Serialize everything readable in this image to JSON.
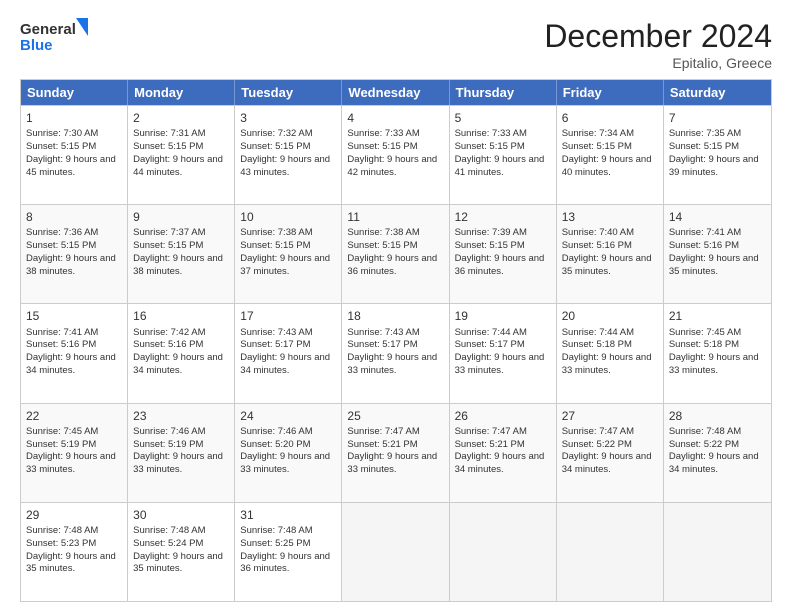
{
  "header": {
    "logo_line1": "General",
    "logo_line2": "Blue",
    "month_title": "December 2024",
    "location": "Epitalio, Greece"
  },
  "weekdays": [
    "Sunday",
    "Monday",
    "Tuesday",
    "Wednesday",
    "Thursday",
    "Friday",
    "Saturday"
  ],
  "rows": [
    [
      {
        "day": "1",
        "sunrise": "Sunrise: 7:30 AM",
        "sunset": "Sunset: 5:15 PM",
        "daylight": "Daylight: 9 hours and 45 minutes."
      },
      {
        "day": "2",
        "sunrise": "Sunrise: 7:31 AM",
        "sunset": "Sunset: 5:15 PM",
        "daylight": "Daylight: 9 hours and 44 minutes."
      },
      {
        "day": "3",
        "sunrise": "Sunrise: 7:32 AM",
        "sunset": "Sunset: 5:15 PM",
        "daylight": "Daylight: 9 hours and 43 minutes."
      },
      {
        "day": "4",
        "sunrise": "Sunrise: 7:33 AM",
        "sunset": "Sunset: 5:15 PM",
        "daylight": "Daylight: 9 hours and 42 minutes."
      },
      {
        "day": "5",
        "sunrise": "Sunrise: 7:33 AM",
        "sunset": "Sunset: 5:15 PM",
        "daylight": "Daylight: 9 hours and 41 minutes."
      },
      {
        "day": "6",
        "sunrise": "Sunrise: 7:34 AM",
        "sunset": "Sunset: 5:15 PM",
        "daylight": "Daylight: 9 hours and 40 minutes."
      },
      {
        "day": "7",
        "sunrise": "Sunrise: 7:35 AM",
        "sunset": "Sunset: 5:15 PM",
        "daylight": "Daylight: 9 hours and 39 minutes."
      }
    ],
    [
      {
        "day": "8",
        "sunrise": "Sunrise: 7:36 AM",
        "sunset": "Sunset: 5:15 PM",
        "daylight": "Daylight: 9 hours and 38 minutes."
      },
      {
        "day": "9",
        "sunrise": "Sunrise: 7:37 AM",
        "sunset": "Sunset: 5:15 PM",
        "daylight": "Daylight: 9 hours and 38 minutes."
      },
      {
        "day": "10",
        "sunrise": "Sunrise: 7:38 AM",
        "sunset": "Sunset: 5:15 PM",
        "daylight": "Daylight: 9 hours and 37 minutes."
      },
      {
        "day": "11",
        "sunrise": "Sunrise: 7:38 AM",
        "sunset": "Sunset: 5:15 PM",
        "daylight": "Daylight: 9 hours and 36 minutes."
      },
      {
        "day": "12",
        "sunrise": "Sunrise: 7:39 AM",
        "sunset": "Sunset: 5:15 PM",
        "daylight": "Daylight: 9 hours and 36 minutes."
      },
      {
        "day": "13",
        "sunrise": "Sunrise: 7:40 AM",
        "sunset": "Sunset: 5:16 PM",
        "daylight": "Daylight: 9 hours and 35 minutes."
      },
      {
        "day": "14",
        "sunrise": "Sunrise: 7:41 AM",
        "sunset": "Sunset: 5:16 PM",
        "daylight": "Daylight: 9 hours and 35 minutes."
      }
    ],
    [
      {
        "day": "15",
        "sunrise": "Sunrise: 7:41 AM",
        "sunset": "Sunset: 5:16 PM",
        "daylight": "Daylight: 9 hours and 34 minutes."
      },
      {
        "day": "16",
        "sunrise": "Sunrise: 7:42 AM",
        "sunset": "Sunset: 5:16 PM",
        "daylight": "Daylight: 9 hours and 34 minutes."
      },
      {
        "day": "17",
        "sunrise": "Sunrise: 7:43 AM",
        "sunset": "Sunset: 5:17 PM",
        "daylight": "Daylight: 9 hours and 34 minutes."
      },
      {
        "day": "18",
        "sunrise": "Sunrise: 7:43 AM",
        "sunset": "Sunset: 5:17 PM",
        "daylight": "Daylight: 9 hours and 33 minutes."
      },
      {
        "day": "19",
        "sunrise": "Sunrise: 7:44 AM",
        "sunset": "Sunset: 5:17 PM",
        "daylight": "Daylight: 9 hours and 33 minutes."
      },
      {
        "day": "20",
        "sunrise": "Sunrise: 7:44 AM",
        "sunset": "Sunset: 5:18 PM",
        "daylight": "Daylight: 9 hours and 33 minutes."
      },
      {
        "day": "21",
        "sunrise": "Sunrise: 7:45 AM",
        "sunset": "Sunset: 5:18 PM",
        "daylight": "Daylight: 9 hours and 33 minutes."
      }
    ],
    [
      {
        "day": "22",
        "sunrise": "Sunrise: 7:45 AM",
        "sunset": "Sunset: 5:19 PM",
        "daylight": "Daylight: 9 hours and 33 minutes."
      },
      {
        "day": "23",
        "sunrise": "Sunrise: 7:46 AM",
        "sunset": "Sunset: 5:19 PM",
        "daylight": "Daylight: 9 hours and 33 minutes."
      },
      {
        "day": "24",
        "sunrise": "Sunrise: 7:46 AM",
        "sunset": "Sunset: 5:20 PM",
        "daylight": "Daylight: 9 hours and 33 minutes."
      },
      {
        "day": "25",
        "sunrise": "Sunrise: 7:47 AM",
        "sunset": "Sunset: 5:21 PM",
        "daylight": "Daylight: 9 hours and 33 minutes."
      },
      {
        "day": "26",
        "sunrise": "Sunrise: 7:47 AM",
        "sunset": "Sunset: 5:21 PM",
        "daylight": "Daylight: 9 hours and 34 minutes."
      },
      {
        "day": "27",
        "sunrise": "Sunrise: 7:47 AM",
        "sunset": "Sunset: 5:22 PM",
        "daylight": "Daylight: 9 hours and 34 minutes."
      },
      {
        "day": "28",
        "sunrise": "Sunrise: 7:48 AM",
        "sunset": "Sunset: 5:22 PM",
        "daylight": "Daylight: 9 hours and 34 minutes."
      }
    ],
    [
      {
        "day": "29",
        "sunrise": "Sunrise: 7:48 AM",
        "sunset": "Sunset: 5:23 PM",
        "daylight": "Daylight: 9 hours and 35 minutes."
      },
      {
        "day": "30",
        "sunrise": "Sunrise: 7:48 AM",
        "sunset": "Sunset: 5:24 PM",
        "daylight": "Daylight: 9 hours and 35 minutes."
      },
      {
        "day": "31",
        "sunrise": "Sunrise: 7:48 AM",
        "sunset": "Sunset: 5:25 PM",
        "daylight": "Daylight: 9 hours and 36 minutes."
      },
      null,
      null,
      null,
      null
    ]
  ]
}
